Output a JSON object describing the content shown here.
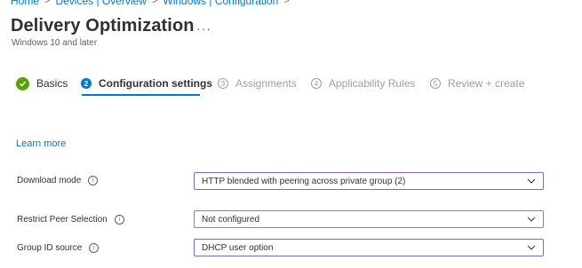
{
  "breadcrumb": {
    "items": [
      "Home",
      "Devices | Overview",
      "Windows | Configuration"
    ]
  },
  "header": {
    "title": "Delivery Optimization",
    "more": "···",
    "subtitle": "Windows 10 and later"
  },
  "steps": [
    {
      "label": "Basics",
      "state": "done",
      "badge": ""
    },
    {
      "label": "Configuration settings",
      "state": "active",
      "badge": "2"
    },
    {
      "label": "Assignments",
      "state": "pending",
      "badge": "3"
    },
    {
      "label": "Applicability Rules",
      "state": "pending",
      "badge": "4"
    },
    {
      "label": "Review + create",
      "state": "pending",
      "badge": "5"
    }
  ],
  "content": {
    "learn_more": "Learn more",
    "fields": [
      {
        "label": "Download mode",
        "value": "HTTP blended with peering across private group (2)",
        "info": "i"
      },
      {
        "label": "Restrict Peer Selection",
        "value": "Not configured",
        "info": "i"
      },
      {
        "label": "Group ID source",
        "value": "DHCP user option",
        "info": "i"
      }
    ]
  },
  "colors": {
    "accent": "#0078d4",
    "success": "#57a300",
    "focus_border": "#8764b8"
  },
  "icons": {
    "check": "checkmark-icon",
    "chevron": "chevron-down-icon",
    "info": "info-icon"
  }
}
